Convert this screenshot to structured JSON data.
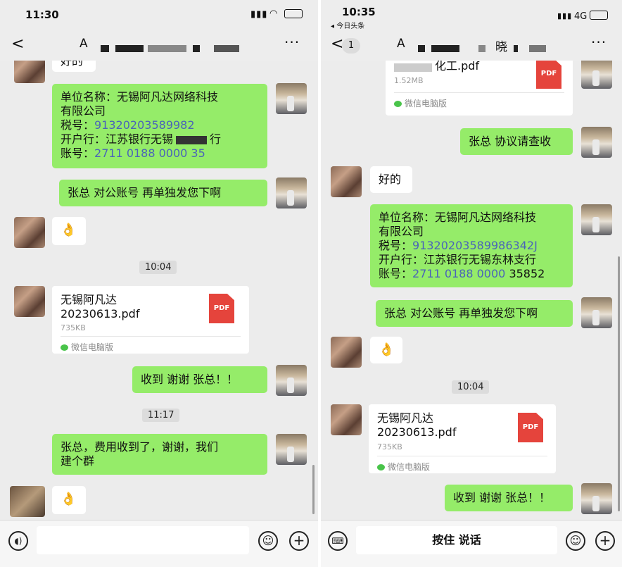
{
  "left": {
    "status_time": "11:30",
    "nav_title": "A",
    "partial_top": "好的",
    "msg_company": {
      "line1": "单位名称：无锡阿凡达网络科技",
      "line2": "有限公司",
      "tax_label": "税号：",
      "tax_value": "91320203589982",
      "bank_label": "开户行：",
      "bank_value": "江苏银行无锡",
      "bank_suffix": "行",
      "acct_label": "账号：",
      "acct_value": "2711 0188 0000 35"
    },
    "msg_account": "张总 对公账号 再单独发您下啊",
    "msg_ok_1": "👌",
    "timestamp_1": "10:04",
    "file": {
      "name_l1": "无锡阿凡达",
      "name_l2": "20230613.pdf",
      "size": "735KB",
      "source": "微信电脑版",
      "icon": "PDF"
    },
    "msg_received": "收到 谢谢 张总！！",
    "timestamp_2": "11:17",
    "msg_paid_l1": "张总，费用收到了，谢谢，我们",
    "msg_paid_l2": "建个群",
    "msg_ok_2": "👌"
  },
  "right": {
    "status_time": "10:35",
    "back_app": "◂ 今日头条",
    "network": "4G",
    "back_count": "1",
    "nav_title": "A",
    "nav_title_2": "晓",
    "file_top": {
      "name": "化工.pdf",
      "size": "1.52MB",
      "source": "微信电脑版",
      "icon": "PDF"
    },
    "msg_check": "张总 协议请查收",
    "msg_ok_text": "好的",
    "msg_company": {
      "line1": "单位名称：无锡阿凡达网络科技",
      "line2": "有限公司",
      "tax_label": "税号：",
      "tax_value": "91320203589986342J",
      "bank_line": "开户行：江苏银行无锡东林支行",
      "acct_label": "账号：",
      "acct_value": "2711 0188 0000",
      "acct_tail": "35852"
    },
    "msg_account": "张总 对公账号 再单独发您下啊",
    "msg_ok_emoji": "👌",
    "timestamp_1": "10:04",
    "file": {
      "name_l1": "无锡阿凡达",
      "name_l2": "20230613.pdf",
      "size": "735KB",
      "source": "微信电脑版",
      "icon": "PDF"
    },
    "msg_received": "收到 谢谢 张总！！",
    "hold_to_talk": "按住 说话"
  },
  "icons": {
    "back": "chevron-left-icon",
    "more": "ellipsis-icon",
    "voice": "voice-icon",
    "emoji": "emoji-icon",
    "plus": "plus-icon",
    "keyboard": "keyboard-icon"
  },
  "colors": {
    "green_bubble": "#95ec69",
    "chat_bg": "#ececec",
    "pdf_red": "#e5443c"
  }
}
